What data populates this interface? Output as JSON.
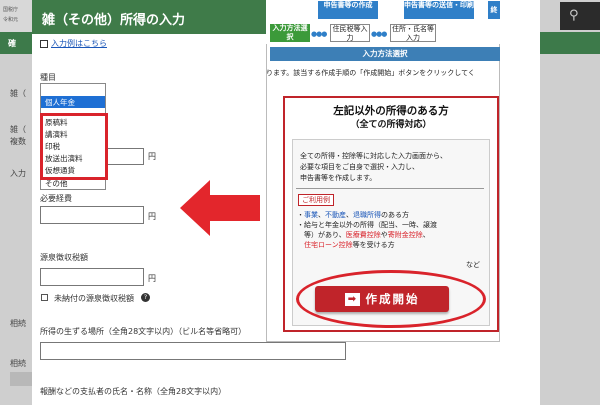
{
  "background": {
    "header_line1": "国税庁",
    "header_line2": "令和元",
    "nav_label": "確",
    "side_items": [
      "雑（",
      "雑（",
      "複数",
      "入力",
      "相続",
      "相続"
    ]
  },
  "modal": {
    "title": "雑（その他）所得の入力",
    "example_link": "入力例はこちら",
    "type_label": "種目",
    "dropdown_options": [
      "個人年金",
      "原稿料",
      "講演料",
      "印税",
      "放送出演料",
      "仮想通貨",
      "その他"
    ],
    "selected_option": "個人年金",
    "yen": "円",
    "expenses_label": "必要経費",
    "withholding_label": "源泉徴収税額",
    "unpaid_checkbox_label": "未納付の源泉徴収税額",
    "help_icon": "?",
    "location_label": "所得の生ずる場所（全角28文字以内）（ビル名等省略可）",
    "payer_label": "報酬などの支払者の氏名・名称（全角28文字以内）"
  },
  "panel": {
    "flow_steps": [
      "申告書等の作成",
      "申告書等の送信・印刷"
    ],
    "flow_step_right": "終",
    "flow_sub": [
      "入力方法選択",
      "住民税等入力",
      "住所・氏名等入力"
    ],
    "method_bar": "入力方法選択",
    "description": "ります。該当する作成手順の「作成開始」ボタンをクリックしてく",
    "card_title": "左記以外の所得のある方",
    "card_subtitle": "（全ての所得対応）",
    "card_desc": [
      "全ての所得・控除等に対応した入力画面から、",
      "必要な項目をご自身で選択・入力し、",
      "申告書等を作成します。"
    ],
    "usage_label": "ご利用例",
    "usage_line1_items": [
      "事業",
      "不動産",
      "退職所得"
    ],
    "usage_line1_tail": "のある方",
    "usage_line2": "・給与と年金以外の所得（配当、一時、譲渡",
    "usage_line3a": "等）があり、",
    "usage_line3_red1": "医療費控除",
    "usage_line3_mid": "や",
    "usage_line3_red2": "寄附金控除",
    "usage_line3_tail": "、",
    "usage_line4_red": "住宅ローン控除",
    "usage_line4_tail": "等を受ける方",
    "nado": "など",
    "start_button": "作成開始"
  },
  "colors": {
    "header_green": "#3f7b49",
    "highlight_red": "#d9232b",
    "selected_blue": "#1e6fd4"
  }
}
